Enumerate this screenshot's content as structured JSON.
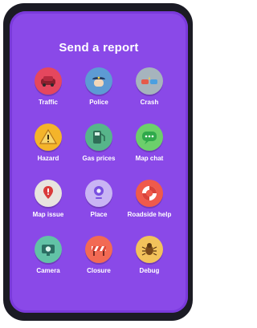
{
  "header": {
    "title": "Send a report"
  },
  "tiles": [
    {
      "label": "Traffic",
      "icon": "car-icon",
      "color": "#e5475e"
    },
    {
      "label": "Police",
      "icon": "police-icon",
      "color": "#5d9bd4"
    },
    {
      "label": "Crash",
      "icon": "crash-icon",
      "color": "#a6b4bd"
    },
    {
      "label": "Hazard",
      "icon": "hazard-icon",
      "color": "#f4b42a"
    },
    {
      "label": "Gas prices",
      "icon": "gas-pump-icon",
      "color": "#57b58a"
    },
    {
      "label": "Map chat",
      "icon": "chat-bubble-icon",
      "color": "#6ccf6b"
    },
    {
      "label": "Map issue",
      "icon": "map-pin-icon",
      "color": "#e8e4df"
    },
    {
      "label": "Place",
      "icon": "place-icon",
      "color": "#c9b4f4"
    },
    {
      "label": "Roadside help",
      "icon": "lifebuoy-icon",
      "color": "#ef5a4c"
    },
    {
      "label": "Camera",
      "icon": "camera-icon",
      "color": "#62c2a6"
    },
    {
      "label": "Closure",
      "icon": "road-closure-icon",
      "color": "#f26a54"
    },
    {
      "label": "Debug",
      "icon": "bug-icon",
      "color": "#f2c25b"
    }
  ]
}
